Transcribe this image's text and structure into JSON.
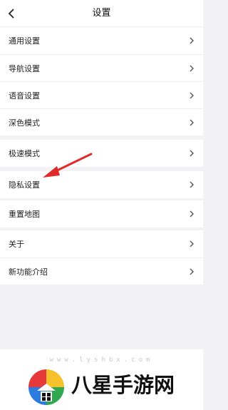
{
  "header": {
    "title": "设置"
  },
  "groups": [
    {
      "items": [
        {
          "label": "通用设置"
        },
        {
          "label": "导航设置"
        },
        {
          "label": "语音设置"
        },
        {
          "label": "深色模式"
        }
      ]
    },
    {
      "items": [
        {
          "label": "极速模式"
        },
        {
          "label": "隐私设置"
        }
      ]
    },
    {
      "items": [
        {
          "label": "重置地图"
        }
      ]
    },
    {
      "items": [
        {
          "label": "关于"
        },
        {
          "label": "新功能介绍"
        }
      ]
    }
  ],
  "icons": {
    "back": "chevron-left-icon",
    "row_chevron": "chevron-right-icon"
  },
  "annotation": {
    "color": "#e02a2a"
  },
  "watermark": {
    "url": "www.lyshbx.com",
    "brand": "八星手游网"
  }
}
